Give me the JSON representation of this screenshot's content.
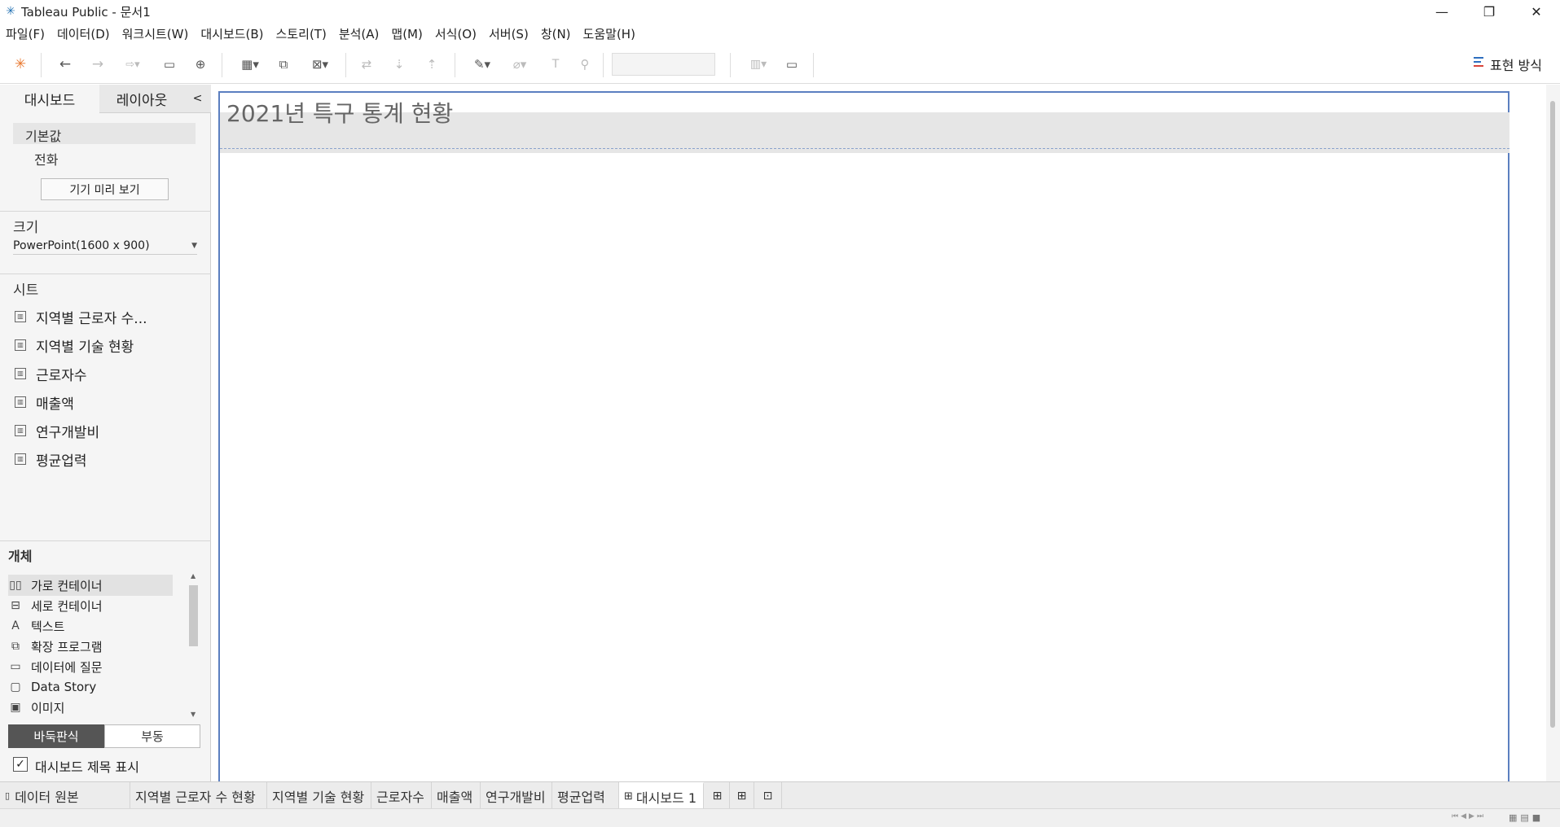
{
  "window": {
    "title": "Tableau Public - 문서1",
    "minimize": "—",
    "restore": "❐",
    "close": "✕"
  },
  "menu": [
    "파일(F)",
    "데이터(D)",
    "워크시트(W)",
    "대시보드(B)",
    "스토리(T)",
    "분석(A)",
    "맵(M)",
    "서식(O)",
    "서버(S)",
    "창(N)",
    "도움말(H)"
  ],
  "toolbar": {
    "show_me_label": "표현 방식"
  },
  "left_pane": {
    "tabs": {
      "dashboard": "대시보드",
      "layout": "레이아웃",
      "collapse": "<"
    },
    "device": {
      "default": "기본값",
      "phone": "전화",
      "preview_button": "기기 미리 보기"
    },
    "size": {
      "heading": "크기",
      "value": "PowerPoint(1600 x 900)"
    },
    "sheets": {
      "heading": "시트",
      "items": [
        "지역별 근로자 수...",
        "지역별 기술 현황",
        "근로자수",
        "매출액",
        "연구개발비",
        "평균업력"
      ]
    },
    "objects": {
      "heading": "개체",
      "items": [
        {
          "label": "가로 컨테이너",
          "icon": "horizontal-container-icon"
        },
        {
          "label": "세로 컨테이너",
          "icon": "vertical-container-icon"
        },
        {
          "label": "텍스트",
          "icon": "text-icon"
        },
        {
          "label": "확장 프로그램",
          "icon": "extension-icon"
        },
        {
          "label": "데이터에 질문",
          "icon": "ask-data-icon"
        },
        {
          "label": "Data Story",
          "icon": "data-story-icon"
        },
        {
          "label": "이미지",
          "icon": "image-icon"
        }
      ],
      "tiled": "바둑판식",
      "floating": "부동"
    },
    "show_title": "대시보드 제목 표시"
  },
  "dashboard": {
    "title": "2021년 특구 통계 현황"
  },
  "bottom_tabs": {
    "data_source": "데이터 원본",
    "sheets": [
      "지역별 근로자 수 현황",
      "지역별 기술 현황",
      "근로자수",
      "매출액",
      "연구개발비",
      "평균업력"
    ],
    "active": "대시보드 1"
  },
  "colors": {
    "accent": "#5b7fc0",
    "title_zone": "#e6e6e6",
    "tiled_active": "#555555"
  }
}
